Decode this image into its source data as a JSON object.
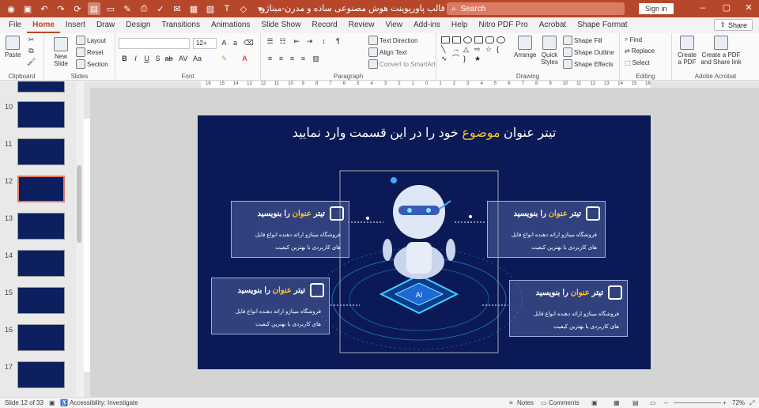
{
  "window": {
    "title": "قالب پاورپوینت هوش مصنوعی ساده و مدرن-میناژو  -  PowerPoint",
    "search_placeholder": "Search",
    "signin": "Sign in"
  },
  "tabs": [
    "File",
    "Home",
    "Insert",
    "Draw",
    "Design",
    "Transitions",
    "Animations",
    "Slide Show",
    "Record",
    "Review",
    "View",
    "Add-ins",
    "Help",
    "Nitro PDF Pro",
    "Acrobat",
    "Shape Format"
  ],
  "active_tab": "Home",
  "share_label": "Share",
  "ribbon": {
    "clipboard": {
      "label": "Clipboard",
      "paste": "Paste"
    },
    "slides": {
      "label": "Slides",
      "new_slide": "New Slide",
      "layout": "Layout",
      "reset": "Reset",
      "section": "Section"
    },
    "font": {
      "label": "Font",
      "font_size": "12+"
    },
    "paragraph": {
      "label": "Paragraph",
      "text_direction": "Text Direction",
      "align_text": "Align Text",
      "convert": "Convert to SmartArt"
    },
    "drawing": {
      "label": "Drawing",
      "arrange": "Arrange",
      "quick_styles": "Quick Styles",
      "shape_fill": "Shape Fill",
      "shape_outline": "Shape Outline",
      "shape_effects": "Shape Effects"
    },
    "editing": {
      "label": "Editing",
      "find": "Find",
      "replace": "Replace",
      "select": "Select"
    },
    "acrobat": {
      "label": "Adobe Acrobat",
      "create_pdf": "Create a PDF",
      "create_share": "Create a PDF and Share link"
    }
  },
  "ruler_ticks": [
    "16",
    "15",
    "14",
    "13",
    "12",
    "11",
    "10",
    "9",
    "8",
    "7",
    "6",
    "5",
    "4",
    "3",
    "2",
    "1",
    "0",
    "1",
    "2",
    "3",
    "4",
    "5",
    "6",
    "7",
    "8",
    "9",
    "10",
    "11",
    "12",
    "13",
    "14",
    "15",
    "16"
  ],
  "thumbnails": [
    {
      "num": "10",
      "selected": false
    },
    {
      "num": "11",
      "selected": false
    },
    {
      "num": "12",
      "selected": true
    },
    {
      "num": "13",
      "selected": false
    },
    {
      "num": "14",
      "selected": false
    },
    {
      "num": "15",
      "selected": false
    },
    {
      "num": "16",
      "selected": false
    },
    {
      "num": "17",
      "selected": false
    }
  ],
  "slide": {
    "title_main": "تیتر عنوان ",
    "title_highlight": "موضوع",
    "title_rest": " خود را در این قسمت وارد نمایید",
    "cards": [
      {
        "title_a": "تیتر ",
        "title_hl": "عنوان",
        "title_b": " را بنویسید",
        "line1": "فروشگاه میناژو ارائه دهنده انواع فایل",
        "line2": "های کاربردی با بهترین کیفیت",
        "icon": "robot-chip-icon"
      },
      {
        "title_a": "تیتر ",
        "title_hl": "عنوان",
        "title_b": " را بنویسید",
        "line1": "فروشگاه میناژو ارائه دهنده انواع فایل",
        "line2": "های کاربردی با بهترین کیفیت",
        "icon": "robot-face-icon"
      },
      {
        "title_a": "تیتر ",
        "title_hl": "عنوان",
        "title_b": " را بنویسید",
        "line1": "فروشگاه میناژو ارائه دهنده انواع فایل",
        "line2": "های کاربردی با بهترین کیفیت",
        "icon": "chip-icon"
      },
      {
        "title_a": "تیتر ",
        "title_hl": "عنوان",
        "title_b": " را بنویسید",
        "line1": "فروشگاه میناژو ارائه دهنده انواع فایل",
        "line2": "های کاربردی با بهترین کیفیت",
        "icon": "network-brain-icon"
      }
    ]
  },
  "status": {
    "slide_counter": "Slide 12 of 33",
    "accessibility": "Accessibility: Investigate",
    "notes": "Notes",
    "comments": "Comments",
    "zoom": "72%"
  },
  "colors": {
    "accent": "#b7472a",
    "slide_bg": "#0b1a56",
    "highlight": "#ffc629"
  }
}
